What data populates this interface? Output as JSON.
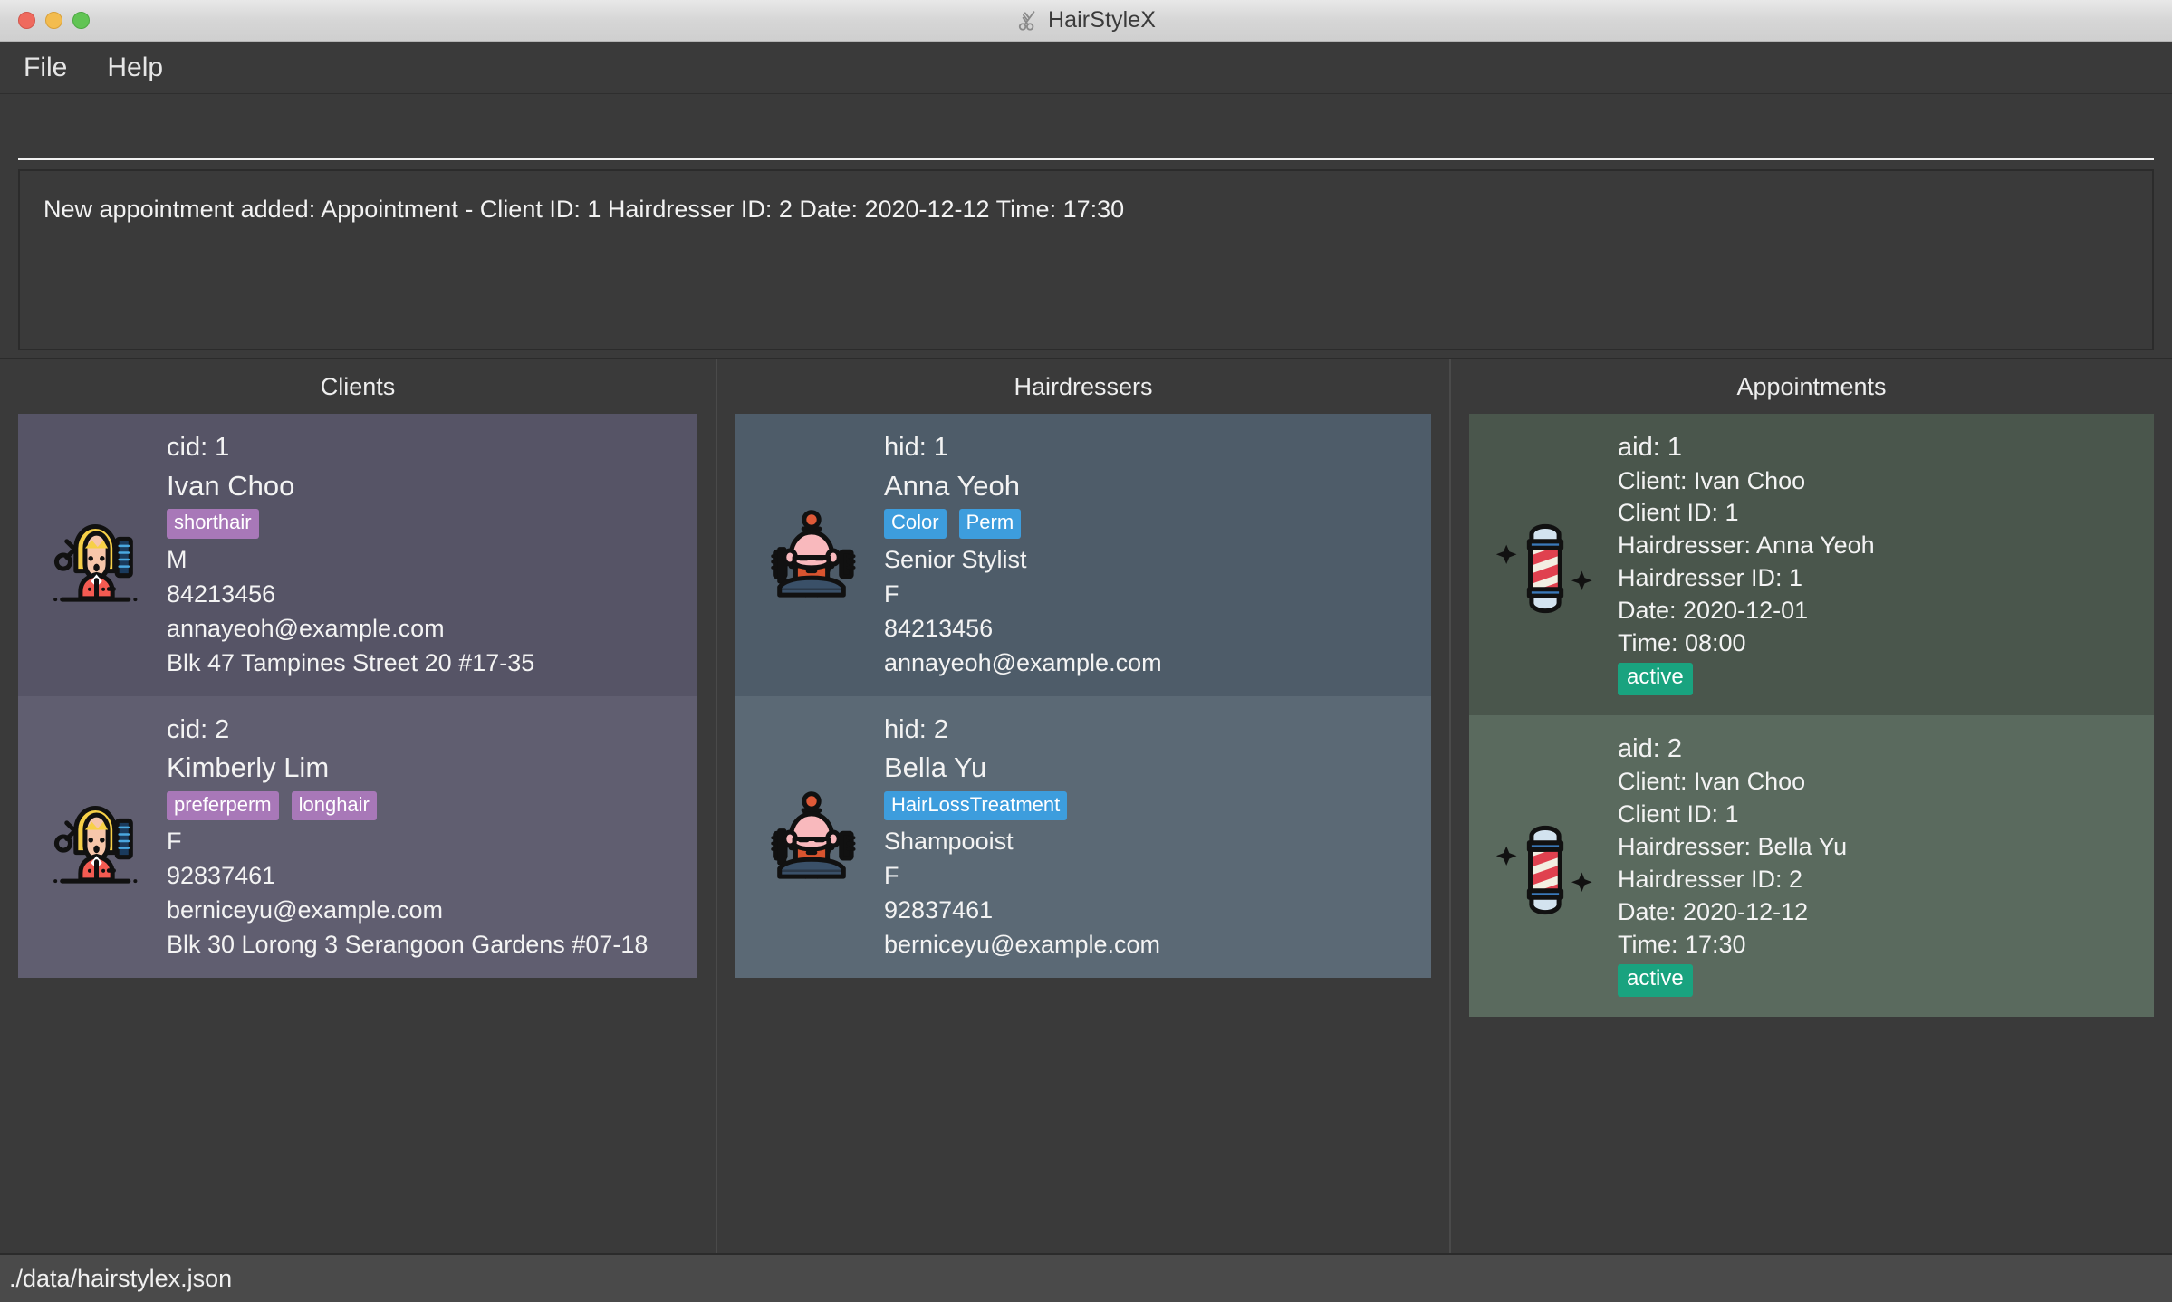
{
  "window": {
    "title": "HairStyleX",
    "title_icon": "scissors-icon"
  },
  "menubar": {
    "items": [
      {
        "label": "File"
      },
      {
        "label": "Help"
      }
    ]
  },
  "command": {
    "value": "",
    "placeholder": ""
  },
  "output": {
    "message": "New appointment added: Appointment - Client ID: 1 Hairdresser ID: 2 Date: 2020-12-12 Time: 17:30"
  },
  "columns": {
    "clients": {
      "header": "Clients",
      "avatar_icon": "hairstylist-woman-icon",
      "items": [
        {
          "id_line": "cid: 1",
          "name": "Ivan Choo",
          "tags": [
            "shorthair"
          ],
          "gender": "M",
          "phone": "84213456",
          "email": "annayeoh@example.com",
          "address": "Blk 47 Tampines Street 20 #17-35"
        },
        {
          "id_line": "cid: 2",
          "name": "Kimberly Lim",
          "tags": [
            "preferperm",
            "longhair"
          ],
          "gender": "F",
          "phone": "92837461",
          "email": "berniceyu@example.com",
          "address": "Blk 30 Lorong 3 Serangoon Gardens #07-18"
        }
      ]
    },
    "hairdressers": {
      "header": "Hairdressers",
      "avatar_icon": "barber-beard-icon",
      "items": [
        {
          "id_line": "hid: 1",
          "name": "Anna Yeoh",
          "tags": [
            "Color",
            "Perm"
          ],
          "title": "Senior Stylist",
          "gender": "F",
          "phone": "84213456",
          "email": "annayeoh@example.com"
        },
        {
          "id_line": "hid: 2",
          "name": "Bella Yu",
          "tags": [
            "HairLossTreatment"
          ],
          "title": "Shampooist",
          "gender": "F",
          "phone": "92837461",
          "email": "berniceyu@example.com"
        }
      ]
    },
    "appointments": {
      "header": "Appointments",
      "avatar_icon": "barber-pole-icon",
      "items": [
        {
          "id_line": "aid: 1",
          "client": "Client:  Ivan Choo",
          "client_id": "Client ID: 1",
          "hairdresser": "Hairdresser:  Anna Yeoh",
          "hairdresser_id": "Hairdresser ID: 1",
          "date": "Date: 2020-12-01",
          "time": "Time: 08:00",
          "status": "active"
        },
        {
          "id_line": "aid: 2",
          "client": "Client:  Ivan Choo",
          "client_id": "Client ID: 1",
          "hairdresser": "Hairdresser:  Bella Yu",
          "hairdresser_id": "Hairdresser ID: 2",
          "date": "Date: 2020-12-12",
          "time": "Time: 17:30",
          "status": "active"
        }
      ]
    }
  },
  "statusbar": {
    "path": "./data/hairstylex.json"
  },
  "colors": {
    "client_card": "#565466",
    "client_tag": "#a878b8",
    "hairdresser_card": "#4e5c69",
    "hairdresser_tag": "#3d9ddd",
    "appointment_card": "#4a564c",
    "appointment_tag": "#19a37f",
    "app_background": "#3a3a3a"
  }
}
